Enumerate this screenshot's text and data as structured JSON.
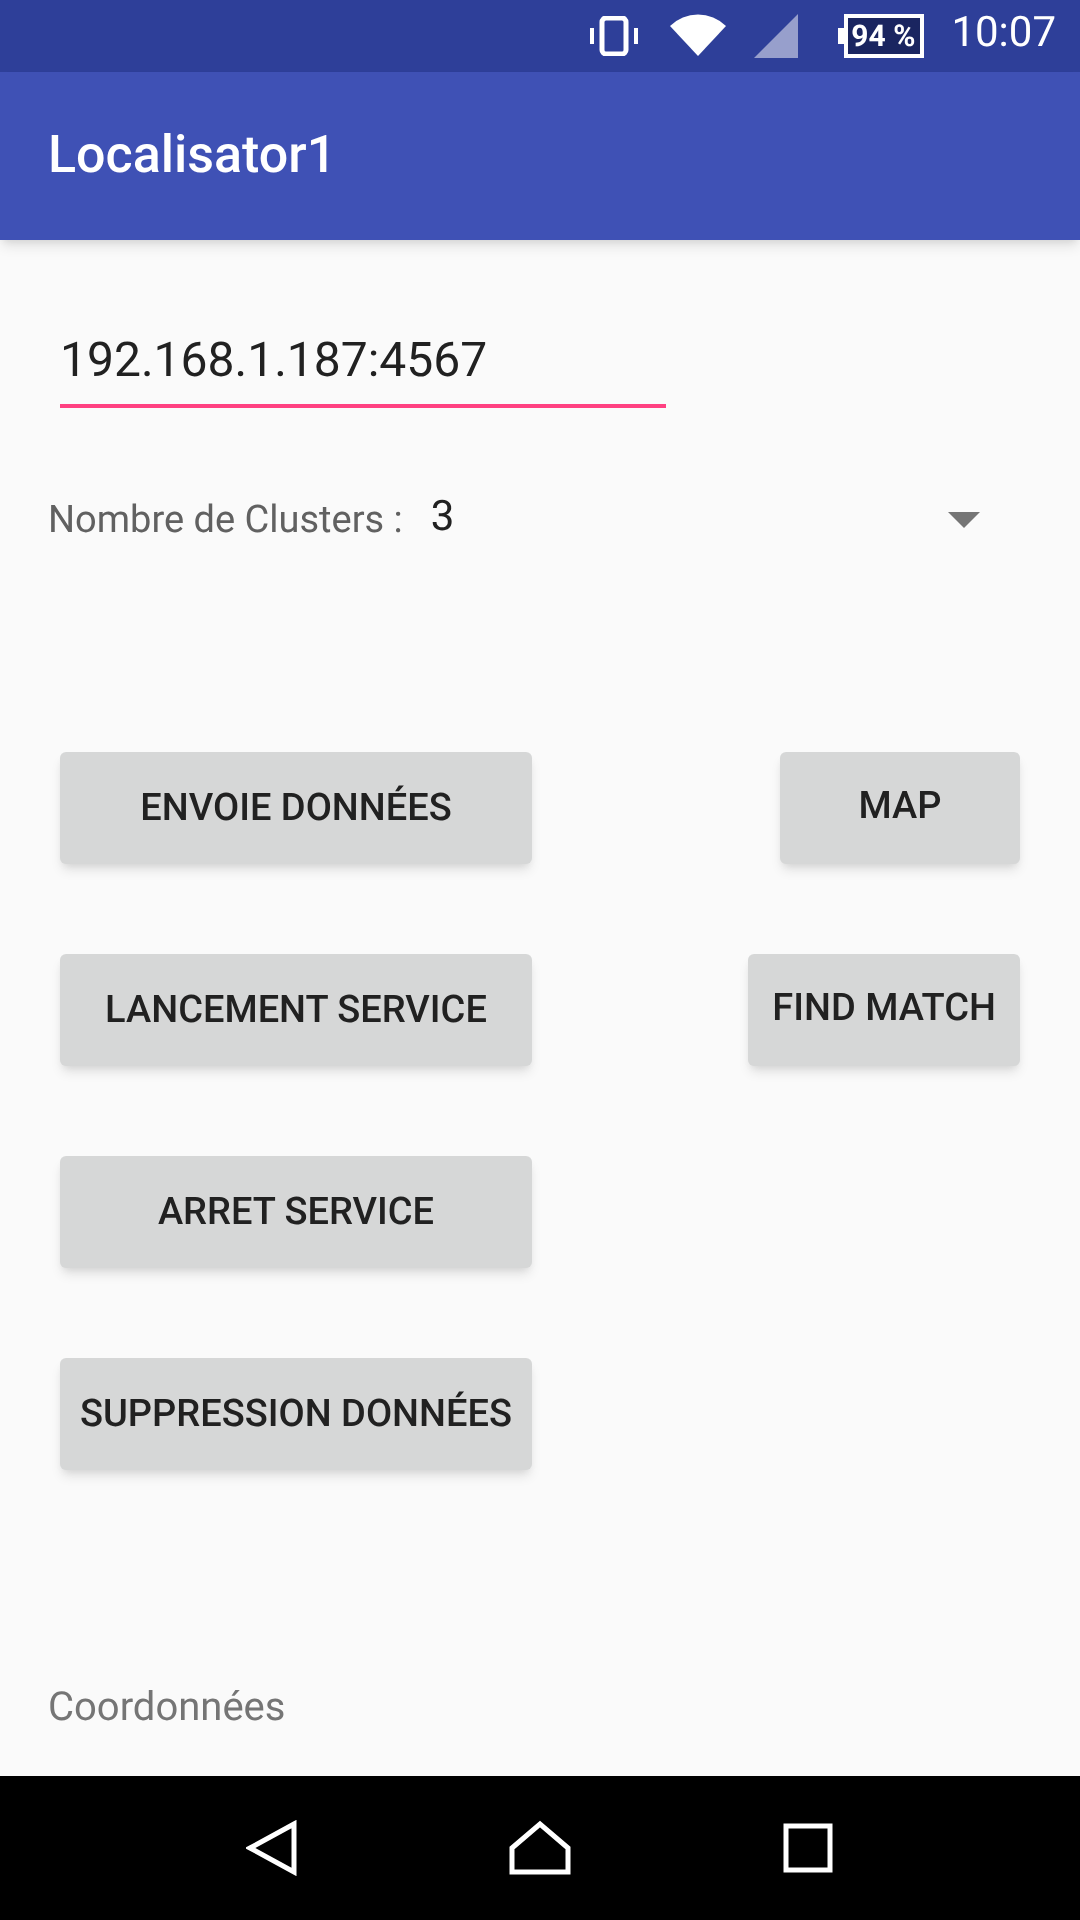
{
  "status_bar": {
    "battery": "94 %",
    "time": "10:07"
  },
  "app_bar": {
    "title": "Localisator1"
  },
  "address_field": {
    "value": "192.168.1.187:4567"
  },
  "clusters": {
    "label": "Nombre de Clusters :",
    "value": "3"
  },
  "button_rows": [
    {
      "left": "ENVOIE DONNÉES",
      "right": "MAP"
    },
    {
      "left": "LANCEMENT SERVICE",
      "right": "FIND MATCH"
    },
    {
      "left": "ARRET SERVICE"
    },
    {
      "left": "SUPPRESSION DONNÉES"
    }
  ],
  "coordinates_label": "Coordonnées"
}
